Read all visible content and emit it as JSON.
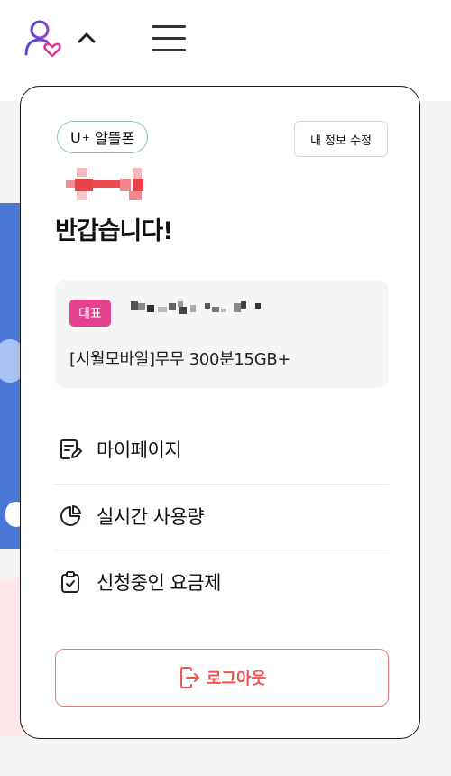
{
  "header": {
    "icons": {
      "user": "user-heart-icon",
      "collapse": "chevron-up-icon",
      "menu": "hamburger-menu-icon"
    }
  },
  "panel": {
    "brand_badge": {
      "prefix": "U",
      "superscript": "+",
      "text": "알뜰폰"
    },
    "edit_profile_label": "내 정보 수정",
    "greeting": "반갑습니다!",
    "plan_card": {
      "badge_label": "대표",
      "plan_name": "[시월모바일]무무 300분15GB+"
    },
    "menu_items": [
      {
        "label": "마이페이지",
        "icon": "document-edit-icon"
      },
      {
        "label": "실시간 사용량",
        "icon": "pie-chart-icon"
      },
      {
        "label": "신청중인 요금제",
        "icon": "clipboard-check-icon"
      }
    ],
    "logout_label": "로그아웃"
  },
  "colors": {
    "accent_purple": "#6a3fc8",
    "accent_pink": "#e4418f",
    "logout_red": "#ef5555",
    "brand_border_green": "#8fc9a3"
  }
}
